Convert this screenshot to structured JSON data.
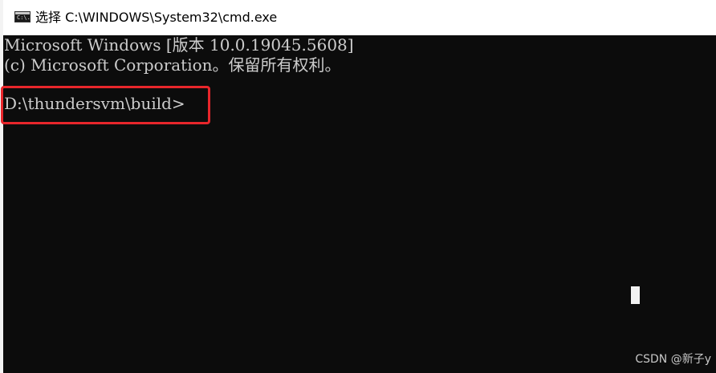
{
  "window": {
    "title": "选择 C:\\WINDOWS\\System32\\cmd.exe",
    "icon": "cmd-console-icon",
    "icon_glyph": "C:\\."
  },
  "console": {
    "lines": [
      "Microsoft Windows [版本 10.0.19045.5608]",
      "(c) Microsoft Corporation。保留所有权利。",
      "D:\\thundersvm\\build>"
    ],
    "highlight_color": "#e8262b",
    "background_color": "#0c0c0c",
    "text_color": "#cccccc"
  },
  "watermark": "CSDN @新子y"
}
